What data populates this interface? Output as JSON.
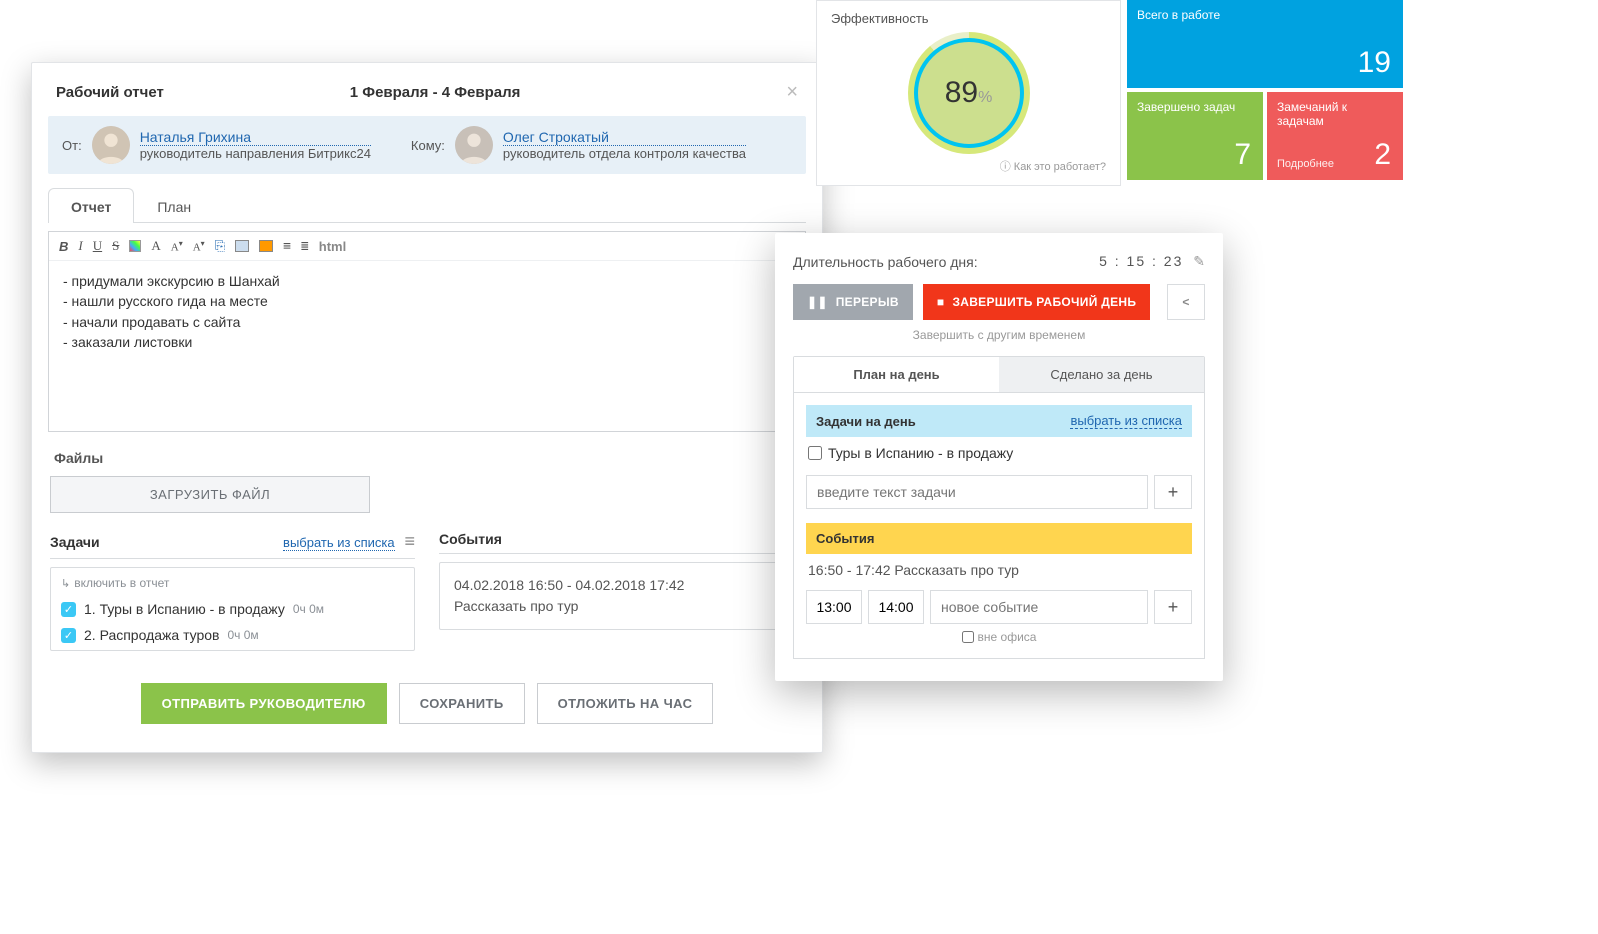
{
  "report": {
    "title": "Рабочий отчет",
    "date_range": "1 Февраля - 4 Февраля",
    "from_label": "От:",
    "from_name": "Наталья Грихина",
    "from_role": "руководитель направления Битрикс24",
    "to_label": "Кому:",
    "to_name": "Олег Строкатый",
    "to_role": "руководитель отдела контроля качества",
    "tabs": {
      "report": "Отчет",
      "plan": "План"
    },
    "toolbar": {
      "html": "html"
    },
    "body": "- придумали экскурсию в Шанхай\n- нашли русского гида на месте\n- начали продавать с сайта\n- заказали листовки",
    "files_label": "Файлы",
    "upload_btn": "ЗАГРУЗИТЬ ФАЙЛ",
    "tasks_title": "Задачи",
    "select_list": "выбрать из списка",
    "include_label": "включить в отчет",
    "tasks": [
      {
        "text": "1. Туры в Испанию - в продажу",
        "time": "0ч 0м"
      },
      {
        "text": "2. Распродажа туров",
        "time": "0ч 0м"
      }
    ],
    "events_title": "События",
    "event_time": "04.02.2018 16:50 - 04.02.2018 17:42",
    "event_text": "Рассказать про тур",
    "buttons": {
      "send": "ОТПРАВИТЬ РУКОВОДИТЕЛЮ",
      "save": "СОХРАНИТЬ",
      "postpone": "ОТЛОЖИТЬ НА ЧАС"
    }
  },
  "effectiveness": {
    "title": "Эффективность",
    "value": "89",
    "pct": "%",
    "help": "Как это работает?"
  },
  "tiles": {
    "total_label": "Всего в работе",
    "total_value": "19",
    "done_label": "Завершено задач",
    "done_value": "7",
    "issues_label": "Замечаний к задачам",
    "issues_value": "2",
    "more": "Подробнее"
  },
  "workday": {
    "duration_label": "Длительность рабочего дня:",
    "duration_value": "5 : 15 : 23",
    "pause": "ПЕРЕРЫВ",
    "stop": "ЗАВЕРШИТЬ РАБОЧИЙ ДЕНЬ",
    "other_time": "Завершить с другим временем",
    "tabs": {
      "plan": "План на день",
      "done": "Сделано за день"
    },
    "tasks_header": "Задачи на день",
    "select_list": "выбрать из списка",
    "task1": "Туры в Испанию - в продажу",
    "task_placeholder": "введите текст задачи",
    "events_header": "События",
    "event_line": "16:50 - 17:42   Рассказать про тур",
    "t1": "13:00",
    "t2": "14:00",
    "event_placeholder": "новое событие",
    "out_office": "вне офиса"
  }
}
